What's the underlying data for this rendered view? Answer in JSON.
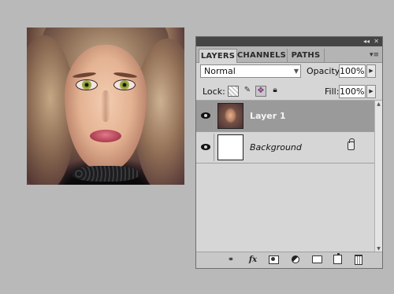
{
  "panel": {
    "tabs": [
      {
        "label": "LAYERS",
        "active": true
      },
      {
        "label": "CHANNELS",
        "active": false
      },
      {
        "label": "PATHS",
        "active": false
      }
    ],
    "titlebar_collapse_icon": "double-chevron-right-icon",
    "blend_mode": "Normal",
    "opacity_label": "Opacity:",
    "opacity_value": "100%",
    "lock_label": "Lock:",
    "fill_label": "Fill:",
    "fill_value": "100%",
    "layers": [
      {
        "name": "Layer 1",
        "visible": true,
        "selected": true,
        "thumbnail": "portrait"
      },
      {
        "name": "Background",
        "visible": true,
        "selected": false,
        "locked": true,
        "thumbnail": "white"
      }
    ],
    "bottom_icons": [
      "link-layers-icon",
      "fx-icon",
      "add-mask-icon",
      "adjustment-layer-icon",
      "new-group-icon",
      "new-layer-icon",
      "delete-icon"
    ],
    "fx_glyph": "fx"
  },
  "colors": {
    "background": "#b9b9b9",
    "panel_bg": "#d6d6d6",
    "titlebar": "#454545",
    "selected_row": "#9a9a9a"
  }
}
